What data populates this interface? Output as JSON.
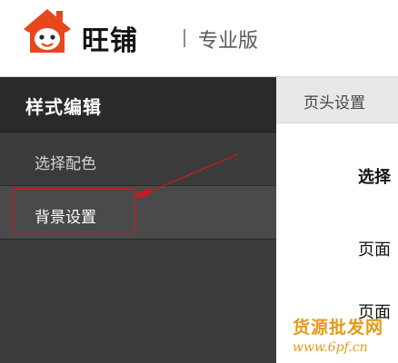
{
  "header": {
    "brand": "旺铺",
    "edition": "专业版"
  },
  "sidebar": {
    "title": "样式编辑",
    "items": [
      {
        "label": "选择配色"
      },
      {
        "label": "背景设置"
      }
    ]
  },
  "main": {
    "tab": "页头设置",
    "labels": [
      "选择",
      "页面",
      "页面"
    ]
  },
  "watermark": {
    "text": "货源批发网",
    "url": "www.6pf.cn"
  },
  "colors": {
    "sidebar_bg": "#3a3a3a",
    "highlight": "#d4151b",
    "logo": "#e8471c",
    "watermark": "#e59a1a"
  }
}
